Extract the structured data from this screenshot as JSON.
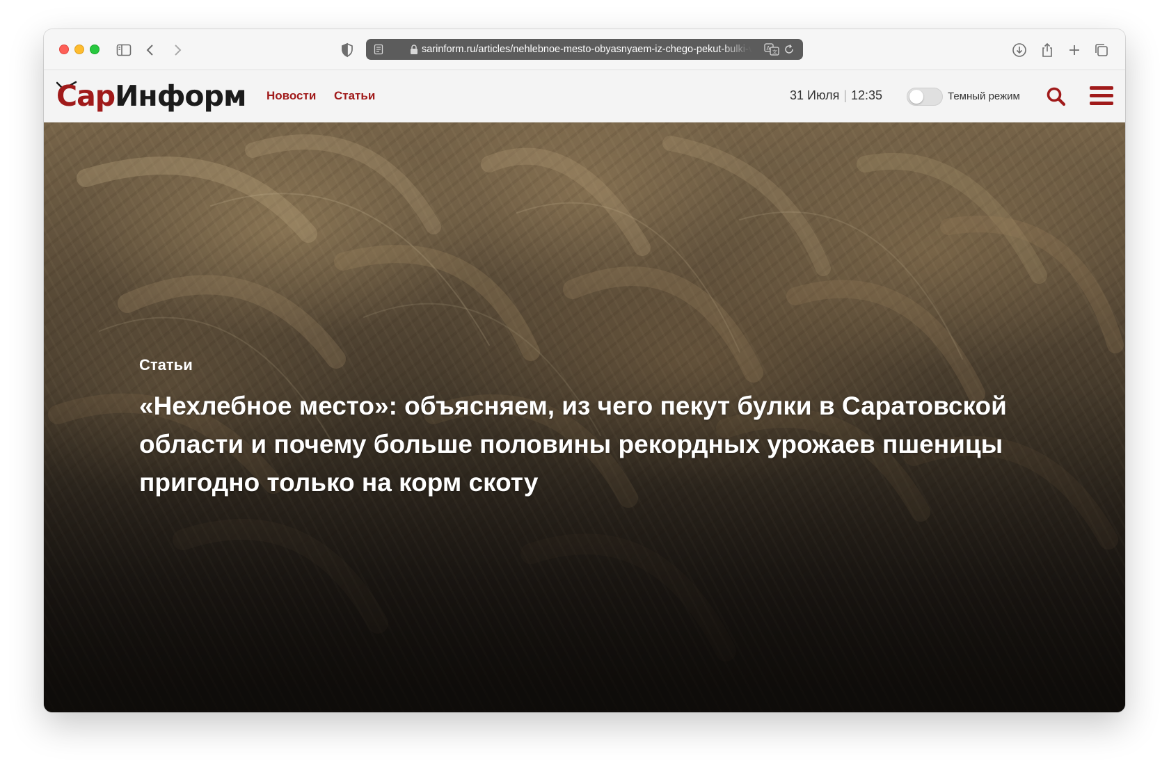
{
  "browser": {
    "url": "sarinform.ru/articles/nehlebnoe-mesto-obyasnyaem-iz-chego-pekut-bulki-v-saratovskoy-oblasti"
  },
  "site": {
    "logo_part1": "Сар",
    "logo_part2": "Информ",
    "nav": {
      "news": "Новости",
      "articles": "Статьи"
    },
    "date": "31 Июля",
    "separator": "|",
    "time": "12:35",
    "dark_mode_label": "Темный режим",
    "dark_mode_enabled": false
  },
  "article": {
    "category": "Статьи",
    "title": "«Нехлебное место»: объясняем, из чего пекут булки в Саратовской области и почему больше половины рекордных урожаев пшеницы пригодно только на корм скоту"
  },
  "colors": {
    "brand": "#a01a1a",
    "logo_dark": "#1b1b1b"
  },
  "icons": {
    "sidebar": "sidebar-icon",
    "back": "chevron-left-icon",
    "forward": "chevron-right-icon",
    "privacy": "shield-icon",
    "reader": "reader-icon",
    "lock": "lock-icon",
    "translate": "translate-icon",
    "reload": "reload-icon",
    "download": "download-icon",
    "share": "share-icon",
    "new_tab": "plus-icon",
    "tabs": "tabs-icon",
    "search": "search-icon",
    "menu": "hamburger-icon"
  }
}
